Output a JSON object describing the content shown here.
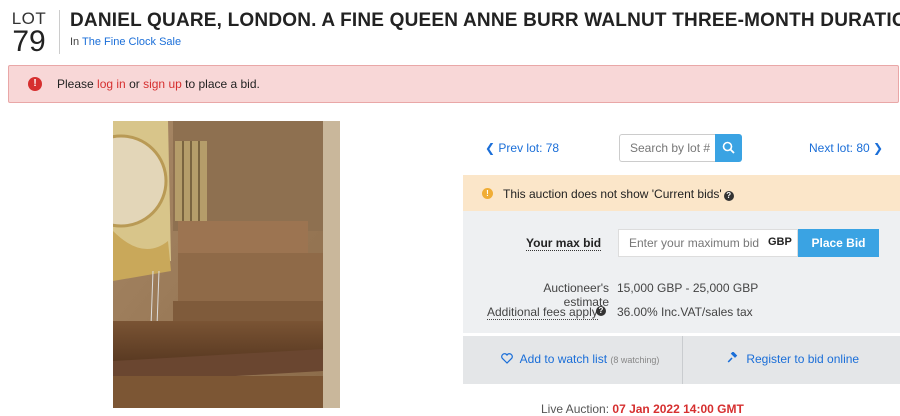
{
  "lot": {
    "word": "LOT",
    "number": "79"
  },
  "title": "DANIEL QUARE, LONDON. A FINE QUEEN ANNE BURR WALNUT THREE-MONTH DURATION",
  "subtitle": {
    "prefix": "In",
    "sale_link": "The Fine Clock Sale"
  },
  "alert": {
    "part1": "Please",
    "login": "log in",
    "part2": "or",
    "signup": "sign up",
    "part3": "to place a bid.",
    "icon": "alert-circle-icon"
  },
  "nav": {
    "prev": "Prev lot: 78",
    "next": "Next lot: 80",
    "search_placeholder": "Search by lot #"
  },
  "notice": {
    "text": "This auction does not show",
    "emphasis": "'Current bids'"
  },
  "bid": {
    "max_label": "Your max bid",
    "input_placeholder": "Enter your maximum bid",
    "currency": "GBP",
    "button": "Place Bid"
  },
  "estimate": {
    "label": "Auctioneer's estimate",
    "value": "15,000 GBP - 25,000 GBP"
  },
  "fees": {
    "label": "Additional fees apply",
    "value": "36.00% Inc.VAT/sales tax"
  },
  "actions": {
    "watch": "Add to watch list",
    "watching": "(8 watching)",
    "register": "Register to bid online"
  },
  "live": {
    "label": "Live Auction:",
    "date": "07 Jan 2022 14:00 GMT"
  },
  "colors": {
    "accent": "#3aa3e3",
    "link": "#1a6ed8",
    "danger": "#d62f2f",
    "notice_bg": "#fbe6c9",
    "alert_bg": "#f8d7d7"
  }
}
